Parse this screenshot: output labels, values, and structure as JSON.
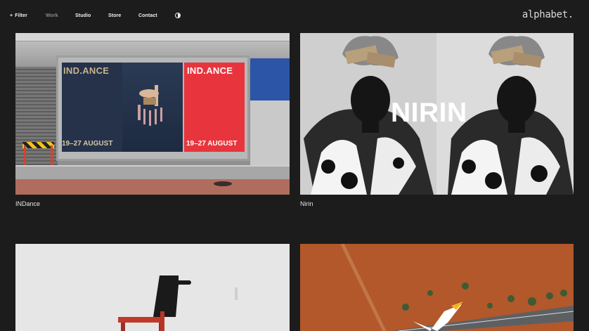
{
  "nav": {
    "filter_label": "Filter",
    "filter_icon": "plus-icon",
    "work_label": "Work",
    "studio_label": "Studio",
    "store_label": "Store",
    "contact_label": "Contact",
    "theme_icon": "half-circle-contrast-icon"
  },
  "logo": "alphabet.",
  "projects": [
    {
      "caption": "INDance",
      "poster_title": "IND.ANCE",
      "poster_dates": "19–27 AUGUST"
    },
    {
      "caption": "Nirin",
      "image_text": "NIRIN"
    },
    {
      "caption": ""
    },
    {
      "caption": ""
    }
  ],
  "colors": {
    "background": "#1c1c1c",
    "text": "#e8e8e8",
    "dim_text": "#8a8a8a",
    "poster_red": "#e8353d"
  }
}
